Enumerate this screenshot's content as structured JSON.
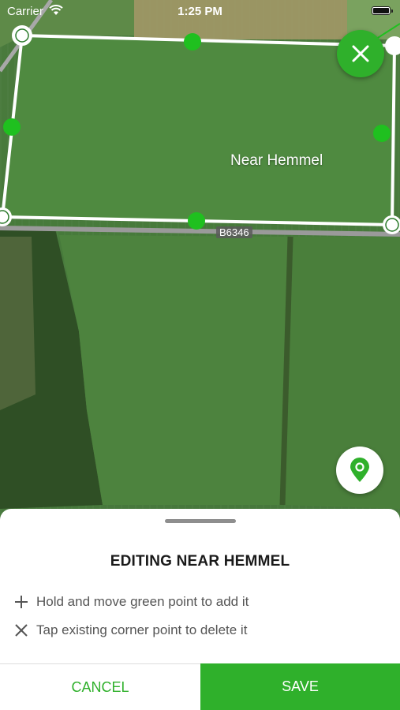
{
  "status_bar": {
    "carrier": "Carrier",
    "time": "1:25 PM",
    "battery_level": 1.0
  },
  "map": {
    "field_name": "Near Hemmel",
    "road_label": "B6346",
    "boundary_color": "#ffffff",
    "midpoint_color": "#1fc01f"
  },
  "controls": {
    "close_icon": "close-icon",
    "locate_icon": "location-pin-icon",
    "accent_color": "#2fb02b"
  },
  "sheet": {
    "title": "EDITING NEAR HEMMEL",
    "hints": [
      {
        "icon": "plus-icon",
        "text": "Hold and move green point to add it"
      },
      {
        "icon": "x-icon",
        "text": "Tap existing corner point to delete it"
      }
    ],
    "cancel_label": "CANCEL",
    "save_label": "SAVE"
  }
}
